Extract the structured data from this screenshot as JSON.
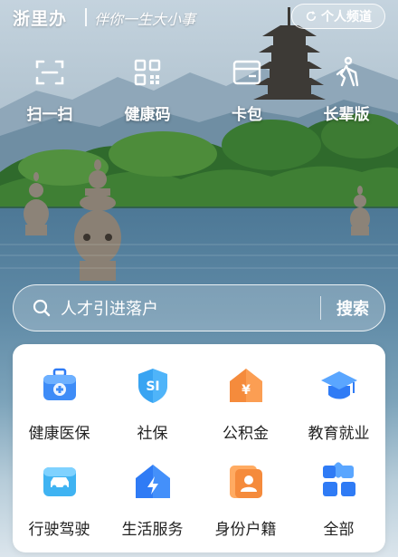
{
  "header": {
    "brand": "浙里办",
    "slogan": "伴你一生大小事",
    "channel_button": "个人频道"
  },
  "quick_actions": [
    {
      "label": "扫一扫",
      "icon": "scan-icon"
    },
    {
      "label": "健康码",
      "icon": "qr-code-icon"
    },
    {
      "label": "卡包",
      "icon": "card-wallet-icon"
    },
    {
      "label": "长辈版",
      "icon": "elder-walking-icon"
    }
  ],
  "search": {
    "placeholder": "人才引进落户",
    "button": "搜索"
  },
  "services": [
    {
      "label": "健康医保",
      "icon": "medical-kit-icon"
    },
    {
      "label": "社保",
      "icon": "social-security-icon"
    },
    {
      "label": "公积金",
      "icon": "housing-fund-icon"
    },
    {
      "label": "教育就业",
      "icon": "graduation-cap-icon"
    },
    {
      "label": "行驶驾驶",
      "icon": "car-license-icon"
    },
    {
      "label": "生活服务",
      "icon": "life-service-icon"
    },
    {
      "label": "身份户籍",
      "icon": "id-card-icon"
    },
    {
      "label": "全部",
      "icon": "all-apps-icon"
    }
  ],
  "colors": {
    "accent_blue": "#2f7bf5",
    "accent_orange": "#f58b3c",
    "water": "#5f8aa6"
  }
}
